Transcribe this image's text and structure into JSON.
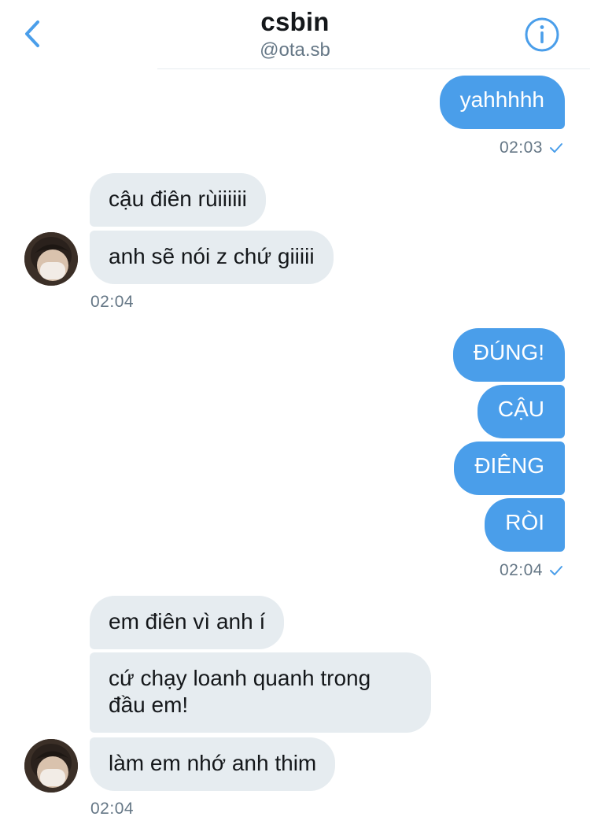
{
  "header": {
    "title": "csbin",
    "handle": "@ota.sb"
  },
  "messages": {
    "m1": {
      "text": "yahhhhh",
      "time": "02:03"
    },
    "g2": {
      "b1": "cậu điên rùiiiiii",
      "b2": "anh sẽ nói z chứ giiiii",
      "time": "02:04"
    },
    "g3": {
      "b1": "ĐÚNG!",
      "b2": "CẬU",
      "b3": "ĐIÊNG",
      "b4": "RÒI",
      "time": "02:04"
    },
    "g4": {
      "b1": "em điên vì anh í",
      "b2": "cứ chạy loanh quanh trong đầu em!",
      "b3": "làm em nhớ anh thim",
      "time": "02:04"
    }
  },
  "colors": {
    "accent": "#4a9eea",
    "received_bubble": "#e6ecf0",
    "secondary_text": "#657786"
  },
  "icons": {
    "back": "chevron-left-icon",
    "info": "info-icon",
    "read": "check-icon"
  }
}
